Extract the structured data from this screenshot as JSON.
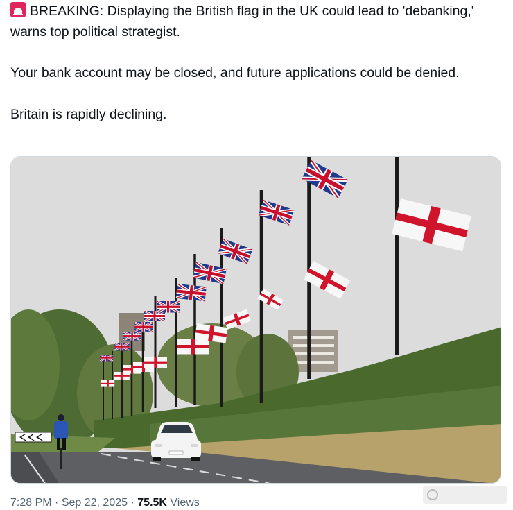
{
  "tweet": {
    "line1": "BREAKING: Displaying the British flag in the UK could lead to 'debanking,' warns top political strategist.",
    "line2": "Your bank account may be closed, and future applications could be denied.",
    "line3": "Britain is rapidly declining.",
    "emoji": "police-siren-icon"
  },
  "photo": {
    "sky_color": "#dcdcdc",
    "road_sign_text": "",
    "car_color": "#f4f4f4"
  },
  "meta": {
    "time": "7:28 PM",
    "date": "Sep 22, 2025",
    "views_count": "75.5K",
    "views_label": "Views",
    "sep": "·"
  },
  "watermark": {
    "text": ""
  }
}
